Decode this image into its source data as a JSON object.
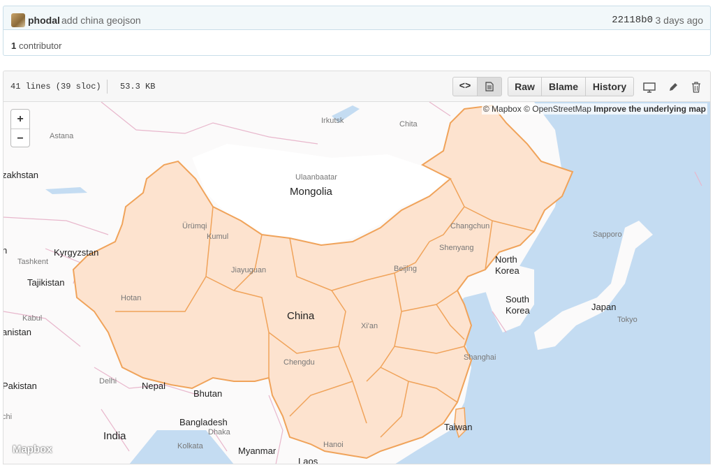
{
  "commit": {
    "author": "phodal",
    "message": "add china geojson",
    "sha": "22118b0",
    "time": "3 days ago"
  },
  "contributors": {
    "count": "1",
    "label": "contributor"
  },
  "file": {
    "lines": "41 lines (39 sloc)",
    "size": "53.3 KB",
    "code_label": "<>",
    "raw_label": "Raw",
    "blame_label": "Blame",
    "history_label": "History"
  },
  "map": {
    "attribution_mapbox": "© Mapbox",
    "attribution_osm": "© OpenStreetMap",
    "attribution_improve": "Improve the underlying map",
    "zoom_in": "+",
    "zoom_out": "−",
    "logo": "Mapbox",
    "colors": {
      "land": "#fbfafa",
      "water": "#c4dcf2",
      "region_fill": "#fde3cf",
      "region_stroke": "#f0a35a",
      "border": "#e8b7cc"
    },
    "labels": {
      "astana": "Astana",
      "irkutsk": "Irkutsk",
      "chita": "Chita",
      "kazakhstan": "zakhstan",
      "ulaanbaatar": "Ulaanbaatar",
      "mongolia": "Mongolia",
      "urumqi": "Ürümqi",
      "kumul": "Kumul",
      "changchun": "Changchun",
      "sapporo": "Sapporo",
      "kyrgyzstan": "Kyrgyzstan",
      "shenyang": "Shenyang",
      "tashkent": "Tashkent",
      "jiayuguan": "Jiayuguan",
      "beijing": "Beijing",
      "north_korea_1": "North",
      "north_korea_2": "Korea",
      "tajikistan": "Tajikistan",
      "hotan": "Hotan",
      "south_korea_1": "South",
      "south_korea_2": "Korea",
      "japan": "Japan",
      "kabul": "Kabul",
      "china": "China",
      "tokyo": "Tokyo",
      "xian": "Xi'an",
      "afghanistan": "anistan",
      "shanghai": "Shanghai",
      "chengdu": "Chengdu",
      "delhi": "Delhi",
      "nepal": "Nepal",
      "pakistan": "Pakistan",
      "bhutan": "Bhutan",
      "bangladesh": "Bangladesh",
      "dhaka": "Dhaka",
      "taiwan": "Taiwan",
      "india": "India",
      "hanoi": "Hanoi",
      "kolkata": "Kolkata",
      "myanmar": "Myanmar",
      "laos": "Laos",
      "n_left": "n",
      "chi": "chi"
    }
  }
}
